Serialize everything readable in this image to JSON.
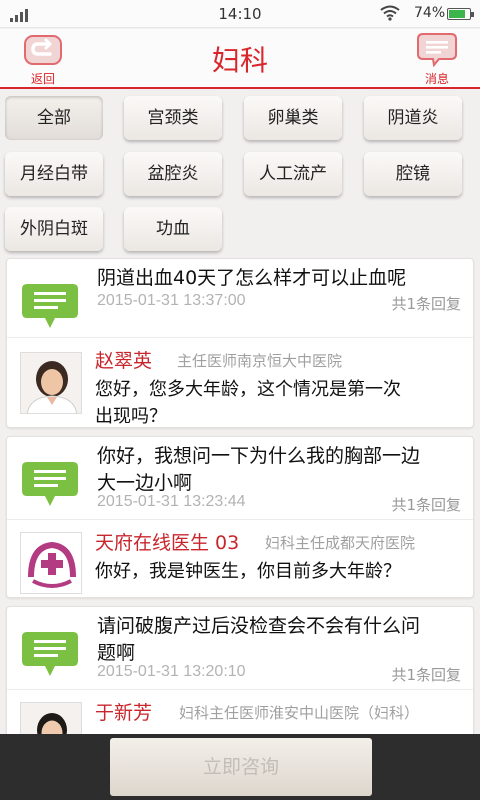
{
  "status": {
    "time": "14:10",
    "battery": "74%"
  },
  "header": {
    "title": "妇科",
    "back_label": "返回",
    "message_label": "消息"
  },
  "categories": [
    "全部",
    "宫颈类",
    "卵巢类",
    "阴道炎",
    "月经白带",
    "盆腔炎",
    "人工流产",
    "腔镜",
    "外阴白斑",
    "功血"
  ],
  "posts": [
    {
      "question_lines": [
        "阴道出血40天了怎么样才可以止血呢"
      ],
      "date": "2015-01-31 13:37:00",
      "replies": "共1条回复",
      "doctor_name": "赵翠英",
      "doctor_title": "主任医师南京恒大中医院",
      "answer_lines": [
        "您好，您多大年龄，这个情况是第一次",
        "出现吗？"
      ]
    },
    {
      "question_lines": [
        "你好，我想问一下为什么我的胸部一边",
        "大一边小啊"
      ],
      "date": "2015-01-31 13:23:44",
      "replies": "共1条回复",
      "doctor_name": "天府在线医生 03",
      "doctor_title": "妇科主任成都天府医院",
      "answer_lines": [
        "你好，我是钟医生，你目前多大年龄？"
      ]
    },
    {
      "question_lines": [
        "请问破腹产过后没检查会不会有什么问",
        "题啊"
      ],
      "date": "2015-01-31 13:20:10",
      "replies": "共1条回复",
      "doctor_name": "于新芳",
      "doctor_title": "妇科主任医师淮安中山医院（妇科）",
      "answer_lines": []
    }
  ],
  "bottom": {
    "consult_label": "立即咨询"
  },
  "colors": {
    "accent": "#d9262c",
    "bubble": "#7bc043",
    "doctor_name": "#c8262c"
  }
}
